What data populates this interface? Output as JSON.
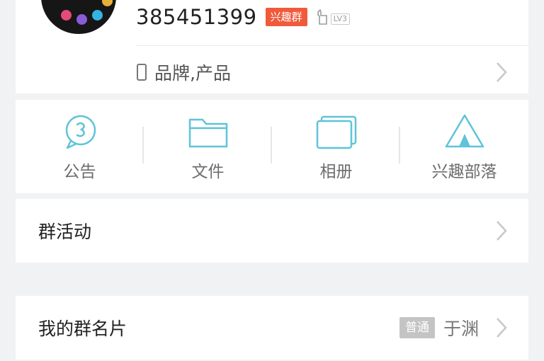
{
  "header": {
    "group_id": "385451399",
    "badge": "兴趣群",
    "level_text": "LV3",
    "category": "品牌,产品"
  },
  "tools": [
    {
      "label": "公告",
      "icon": "announcement-icon"
    },
    {
      "label": "文件",
      "icon": "folder-icon"
    },
    {
      "label": "相册",
      "icon": "album-icon"
    },
    {
      "label": "兴趣部落",
      "icon": "tribe-icon"
    }
  ],
  "rows": {
    "activity": {
      "title": "群活动"
    },
    "namecard": {
      "title": "我的群名片",
      "tag": "普通",
      "value": "于渊"
    }
  },
  "colors": {
    "accent_teal": "#5fc3d9",
    "badge_red": "#f05a3b",
    "chevron_grey": "#c8c8c8",
    "background": "#f1f2f4"
  }
}
